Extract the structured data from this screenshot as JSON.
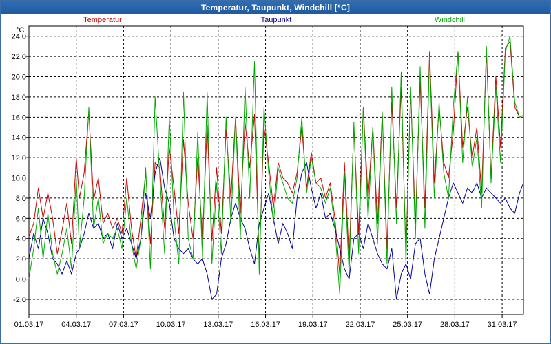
{
  "window": {
    "title": "Temperatur, Taupunkt, Windchill [°C]"
  },
  "chart_data": {
    "type": "line",
    "title": "Temperatur, Taupunkt, Windchill [°C]",
    "ylabel": "°C",
    "xlabel": "",
    "ylim": [
      -3.5,
      25
    ],
    "xlim": [
      0,
      31.35
    ],
    "yticks": [
      -2,
      0,
      2,
      4,
      6,
      8,
      10,
      12,
      14,
      16,
      18,
      20,
      22,
      24
    ],
    "ytick_labels": [
      "-2,0",
      "0,0",
      "2,0",
      "4,0",
      "6,0",
      "8,0",
      "10,0",
      "12,0",
      "14,0",
      "16,0",
      "18,0",
      "20,0",
      "22,0",
      "24,0"
    ],
    "xticks": [
      0,
      3,
      6,
      9,
      12,
      15,
      18,
      21,
      24,
      27,
      30
    ],
    "xtick_labels": [
      "01.03.17",
      "04.03.17",
      "07.03.17",
      "10.03.17",
      "13.03.17",
      "16.03.17",
      "19.03.17",
      "22.03.17",
      "25.03.17",
      "28.03.17",
      "31.03.17"
    ],
    "grid": true,
    "legend_placement": "top",
    "series": [
      {
        "name": "Temperatur",
        "color": "#cc0000",
        "x": [
          0,
          0.3,
          0.6,
          0.9,
          1.2,
          1.5,
          1.8,
          2.1,
          2.4,
          2.7,
          3.0,
          3.2,
          3.5,
          3.8,
          4.1,
          4.4,
          4.7,
          5.0,
          5.3,
          5.6,
          5.9,
          6.2,
          6.5,
          6.8,
          7.1,
          7.4,
          7.7,
          8.0,
          8.3,
          8.6,
          8.9,
          9.2,
          9.5,
          9.8,
          10.1,
          10.4,
          10.7,
          11.0,
          11.3,
          11.6,
          11.9,
          12.2,
          12.5,
          12.8,
          13.1,
          13.4,
          13.7,
          14.0,
          14.3,
          14.6,
          14.9,
          15.2,
          15.5,
          15.8,
          16.1,
          16.4,
          16.7,
          17.0,
          17.3,
          17.6,
          17.9,
          18.2,
          18.5,
          18.8,
          19.1,
          19.4,
          19.7,
          20.0,
          20.3,
          20.6,
          20.9,
          21.2,
          21.5,
          21.8,
          22.1,
          22.4,
          22.7,
          23.0,
          23.3,
          23.6,
          23.9,
          24.2,
          24.5,
          24.8,
          25.1,
          25.4,
          25.7,
          26.0,
          26.3,
          26.6,
          26.9,
          27.2,
          27.5,
          27.8,
          28.1,
          28.4,
          28.7,
          29.0,
          29.3,
          29.6,
          29.9,
          30.2,
          30.5,
          30.8,
          31.1,
          31.35
        ],
        "values": [
          4.2,
          5.5,
          9.0,
          6.0,
          8.5,
          6.0,
          2.5,
          4.8,
          7.5,
          3.5,
          12.0,
          8.0,
          10.5,
          16.5,
          7.8,
          10.0,
          5.5,
          6.5,
          5.0,
          6.0,
          4.5,
          10.0,
          5.0,
          2.0,
          6.0,
          10.5,
          3.5,
          11.5,
          11.0,
          5.0,
          13.0,
          9.0,
          4.5,
          13.8,
          7.5,
          4.0,
          12.0,
          4.0,
          15.2,
          3.8,
          11.0,
          4.5,
          14.8,
          8.0,
          16.0,
          6.5,
          15.5,
          11.0,
          16.3,
          2.0,
          15.0,
          11.5,
          7.0,
          11.5,
          10.0,
          9.5,
          8.5,
          10.5,
          15.0,
          9.0,
          12.5,
          9.5,
          10.0,
          8.0,
          9.5,
          6.0,
          0.5,
          11.5,
          2.0,
          15.0,
          4.5,
          17.0,
          8.0,
          15.0,
          5.5,
          16.5,
          3.0,
          17.5,
          7.0,
          19.0,
          2.5,
          18.5,
          5.5,
          19.5,
          7.0,
          22.5,
          9.5,
          17.0,
          11.5,
          10.0,
          14.5,
          22.5,
          13.0,
          17.0,
          12.0,
          15.0,
          8.5,
          22.5,
          10.0,
          20.0,
          13.0,
          22.8,
          23.5,
          17.0,
          16.0,
          16.2
        ]
      },
      {
        "name": "Taupunkt",
        "color": "#000099",
        "x": [
          0,
          0.3,
          0.6,
          0.9,
          1.2,
          1.5,
          1.8,
          2.1,
          2.4,
          2.7,
          3.0,
          3.2,
          3.5,
          3.8,
          4.1,
          4.4,
          4.7,
          5.0,
          5.3,
          5.6,
          5.9,
          6.2,
          6.5,
          6.8,
          7.1,
          7.4,
          7.7,
          8.0,
          8.3,
          8.6,
          8.9,
          9.2,
          9.5,
          9.8,
          10.1,
          10.4,
          10.7,
          11.0,
          11.3,
          11.6,
          11.9,
          12.2,
          12.5,
          12.8,
          13.1,
          13.4,
          13.7,
          14.0,
          14.3,
          14.6,
          14.9,
          15.2,
          15.5,
          15.8,
          16.1,
          16.4,
          16.7,
          17.0,
          17.3,
          17.6,
          17.9,
          18.2,
          18.5,
          18.8,
          19.1,
          19.4,
          19.7,
          20.0,
          20.3,
          20.6,
          20.9,
          21.2,
          21.5,
          21.8,
          22.1,
          22.4,
          22.7,
          23.0,
          23.3,
          23.6,
          23.9,
          24.2,
          24.5,
          24.8,
          25.1,
          25.4,
          25.7,
          26.0,
          26.3,
          26.6,
          26.9,
          27.2,
          27.5,
          27.8,
          28.1,
          28.4,
          28.7,
          29.0,
          29.3,
          29.6,
          29.9,
          30.2,
          30.5,
          30.8,
          31.1,
          31.35
        ],
        "values": [
          2.0,
          4.5,
          3.0,
          6.0,
          4.5,
          2.0,
          1.5,
          0.5,
          1.8,
          0.5,
          2.5,
          3.0,
          4.5,
          6.5,
          5.0,
          5.5,
          4.0,
          4.5,
          3.0,
          5.5,
          4.0,
          5.0,
          3.5,
          2.0,
          4.0,
          8.5,
          6.0,
          10.5,
          12.0,
          9.0,
          7.5,
          4.0,
          3.0,
          2.5,
          3.0,
          2.0,
          1.5,
          2.0,
          0.5,
          -2.0,
          -1.5,
          2.0,
          3.5,
          6.0,
          7.5,
          6.0,
          5.0,
          3.0,
          1.5,
          5.5,
          7.0,
          8.5,
          6.0,
          3.5,
          5.5,
          4.5,
          3.0,
          8.0,
          10.5,
          11.5,
          9.0,
          7.0,
          8.5,
          6.0,
          6.5,
          5.0,
          3.0,
          1.0,
          0.0,
          4.0,
          4.5,
          3.0,
          5.5,
          4.0,
          2.5,
          1.5,
          1.0,
          3.0,
          -2.0,
          0.5,
          1.5,
          0.0,
          3.5,
          4.0,
          0.5,
          -1.5,
          2.0,
          4.0,
          6.0,
          8.0,
          9.5,
          8.5,
          7.5,
          9.0,
          8.5,
          9.5,
          8.0,
          9.0,
          8.5,
          8.0,
          7.5,
          8.0,
          7.0,
          6.5,
          8.5,
          9.5
        ]
      },
      {
        "name": "Windchill",
        "color": "#00aa00",
        "x": [
          0,
          0.3,
          0.6,
          0.9,
          1.2,
          1.5,
          1.8,
          2.1,
          2.4,
          2.7,
          3.0,
          3.2,
          3.5,
          3.8,
          4.1,
          4.4,
          4.7,
          5.0,
          5.3,
          5.6,
          5.9,
          6.2,
          6.5,
          6.8,
          7.1,
          7.4,
          7.7,
          8.0,
          8.3,
          8.6,
          8.9,
          9.2,
          9.5,
          9.8,
          10.1,
          10.4,
          10.7,
          11.0,
          11.3,
          11.6,
          11.9,
          12.2,
          12.5,
          12.8,
          13.1,
          13.4,
          13.7,
          14.0,
          14.3,
          14.6,
          14.9,
          15.2,
          15.5,
          15.8,
          16.1,
          16.4,
          16.7,
          17.0,
          17.3,
          17.6,
          17.9,
          18.2,
          18.5,
          18.8,
          19.1,
          19.4,
          19.7,
          20.0,
          20.3,
          20.6,
          20.9,
          21.2,
          21.5,
          21.8,
          22.1,
          22.4,
          22.7,
          23.0,
          23.3,
          23.6,
          23.9,
          24.2,
          24.5,
          24.8,
          25.1,
          25.4,
          25.7,
          26.0,
          26.3,
          26.6,
          26.9,
          27.2,
          27.5,
          27.8,
          28.1,
          28.4,
          28.7,
          29.0,
          29.3,
          29.6,
          29.9,
          30.2,
          30.5,
          30.8,
          31.1,
          31.35
        ],
        "values": [
          0.0,
          3.0,
          7.0,
          2.0,
          6.5,
          2.5,
          0.5,
          2.5,
          5.0,
          1.0,
          10.0,
          3.0,
          8.0,
          17.0,
          5.0,
          8.0,
          3.5,
          4.5,
          4.0,
          5.0,
          3.0,
          8.0,
          3.5,
          1.0,
          4.0,
          11.0,
          1.0,
          18.0,
          10.0,
          2.5,
          16.0,
          6.0,
          1.5,
          18.5,
          4.0,
          2.0,
          14.5,
          2.0,
          18.5,
          1.5,
          9.5,
          2.5,
          16.0,
          5.5,
          16.0,
          4.0,
          19.0,
          8.0,
          21.5,
          0.5,
          17.0,
          10.5,
          5.5,
          11.0,
          9.5,
          8.0,
          7.5,
          10.0,
          16.0,
          8.5,
          12.0,
          9.5,
          9.0,
          7.5,
          9.0,
          5.0,
          -1.5,
          10.5,
          0.5,
          15.5,
          2.5,
          17.0,
          6.0,
          15.0,
          3.5,
          16.5,
          1.5,
          19.0,
          5.5,
          20.5,
          1.5,
          19.0,
          4.0,
          21.0,
          5.0,
          22.0,
          8.0,
          17.5,
          10.5,
          8.0,
          17.0,
          22.5,
          11.5,
          18.0,
          11.0,
          14.0,
          7.0,
          23.0,
          9.5,
          19.0,
          11.5,
          22.5,
          24.0,
          17.5,
          16.0,
          16.2
        ]
      }
    ]
  }
}
